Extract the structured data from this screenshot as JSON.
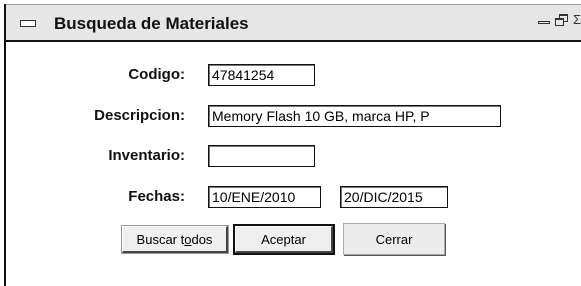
{
  "window": {
    "title": "Busqueda de Materiales"
  },
  "form": {
    "codigo_label": "Codigo:",
    "codigo_value": "47841254",
    "descripcion_label": "Descripcion:",
    "descripcion_value": "Memory Flash 10 GB, marca HP, P",
    "inventario_label": "Inventario:",
    "inventario_value": "",
    "fechas_label": "Fechas:",
    "fecha_inicio": "10/ENE/2010",
    "fecha_fin": "20/DIC/2015"
  },
  "buttons": {
    "buscar_todos_pre": "Buscar t",
    "buscar_todos_mnemonic": "o",
    "buscar_todos_post": "dos",
    "aceptar": "Aceptar",
    "cerrar": "Cerrar"
  },
  "icons": {
    "system_menu": "window-menu-icon",
    "minimize": "minimize-icon",
    "restore": "restore-icon",
    "close": "close-icon"
  }
}
